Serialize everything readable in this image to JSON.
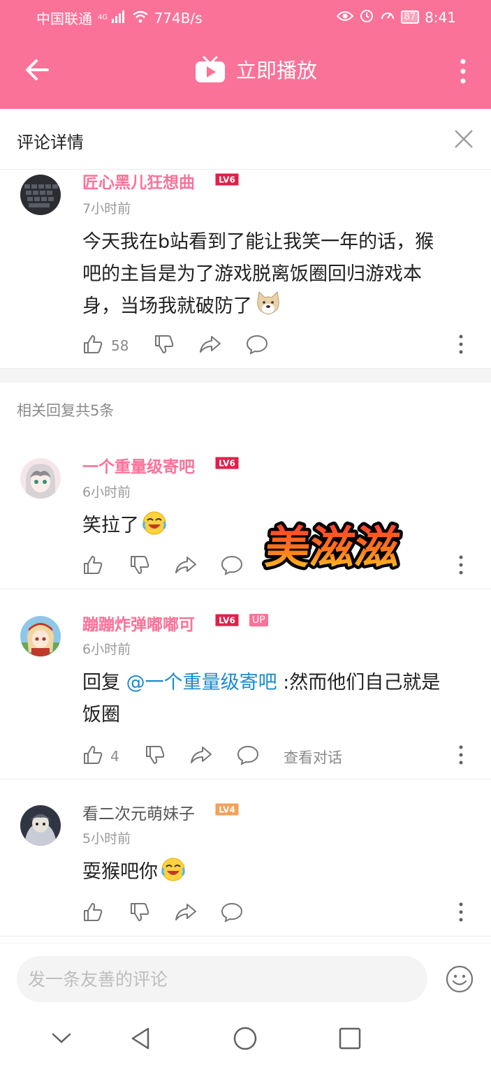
{
  "status_bar": {
    "carrier": "中国联通",
    "network": "4G",
    "speed": "774B/s",
    "battery": "87",
    "time": "8:41"
  },
  "app_bar": {
    "title": "立即播放"
  },
  "detail": {
    "title": "评论详情"
  },
  "main_comment": {
    "username": "匠心黑儿狂想曲",
    "level": "LV6",
    "time": "7小时前",
    "line1": "今天我在b站看到了能让我笑一年的话，猴",
    "line2": "吧的主旨是为了游戏脱离饭圈回归游戏本",
    "line3": "身，当场我就破防了",
    "likes": "58"
  },
  "replies_header": "相关回复共5条",
  "replies": [
    {
      "username": "一个重量级寄吧",
      "level": "LV6",
      "time": "6小时前",
      "text": "笑拉了"
    },
    {
      "username": "蹦蹦炸弹嘟嘟可",
      "level": "LV6",
      "badge": "UP",
      "time": "6小时前",
      "reply_prefix": "回复 ",
      "mention": "@一个重量级寄吧",
      "text_after": " :然而他们自己就是",
      "text_line2": "饭圈",
      "likes": "4",
      "view_conversation": "查看对话"
    },
    {
      "username": "看二次元萌妹子",
      "level": "LV4",
      "time": "5小时前",
      "text": "耍猴吧你"
    }
  ],
  "sticker_text": "美滋滋",
  "input": {
    "placeholder": "发一条友善的评论"
  },
  "colors": {
    "brand": "#fb7299",
    "mention": "#178bcf",
    "lv6": "#e0204a",
    "lv4": "#f5a05a"
  }
}
